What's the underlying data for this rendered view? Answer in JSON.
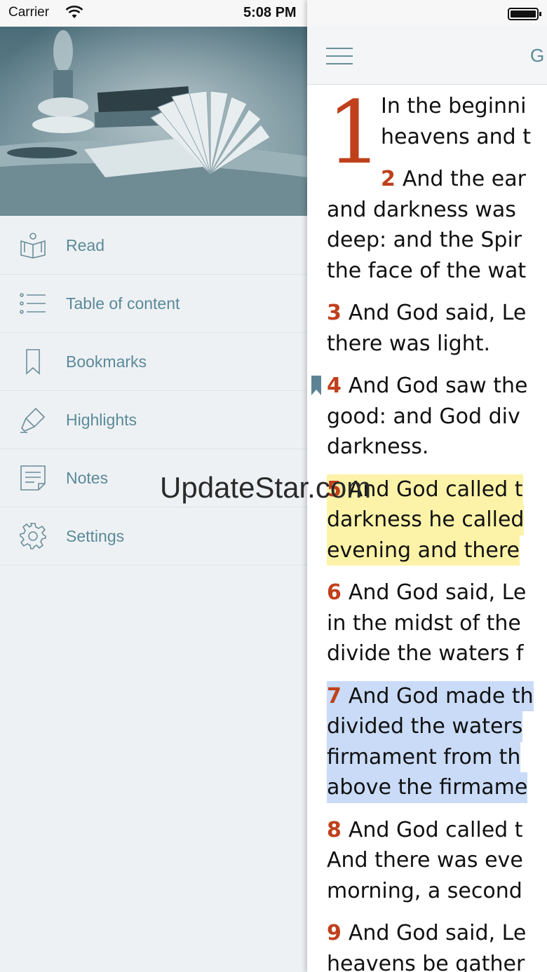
{
  "status_bar": {
    "carrier": "Carrier",
    "time": "5:08 PM"
  },
  "hero": {
    "image": "still-life-oil-lamp-and-open-book"
  },
  "menu": {
    "items": [
      {
        "label": "Read",
        "icon": "book-reader-icon"
      },
      {
        "label": "Table of content",
        "icon": "list-icon"
      },
      {
        "label": "Bookmarks",
        "icon": "bookmark-icon"
      },
      {
        "label": "Highlights",
        "icon": "highlighter-icon"
      },
      {
        "label": "Notes",
        "icon": "note-icon"
      },
      {
        "label": "Settings",
        "icon": "gear-icon"
      }
    ]
  },
  "reader": {
    "title": "G",
    "chapter": "1",
    "verses": [
      {
        "number": "",
        "lines": [
          "In the beginni",
          "heavens and t"
        ]
      },
      {
        "number": "2",
        "lines": [
          "And the ear",
          "and darkness was",
          "deep: and the Spir",
          "the face of the wat"
        ]
      },
      {
        "number": "3",
        "lines": [
          "And God said, Le",
          "there was light."
        ]
      },
      {
        "number": "4",
        "lines": [
          "And God saw the",
          "good: and God div",
          "darkness."
        ],
        "bookmarked": true
      },
      {
        "number": "5",
        "lines": [
          "And God called t",
          "darkness he called",
          "evening and there"
        ],
        "highlight": "yellow"
      },
      {
        "number": "6",
        "lines": [
          "And God said, Le",
          "in the midst of the",
          "divide the waters f"
        ]
      },
      {
        "number": "7",
        "lines": [
          "And God made th",
          "divided the waters",
          "firmament from th",
          "above the firmame"
        ],
        "highlight": "blue"
      },
      {
        "number": "8",
        "lines": [
          "And God called t",
          "And there was eve",
          "morning, a second"
        ]
      },
      {
        "number": "9",
        "lines": [
          "And God said, Le",
          "heavens be gather"
        ]
      }
    ]
  },
  "colors": {
    "accent": "#5a8a98",
    "verse_number": "#c0401c",
    "highlight_yellow": "#fdf3a8",
    "highlight_blue": "#c9dbf7",
    "drawer_bg": "#eef1f4"
  },
  "watermark": "UpdateStar.com"
}
